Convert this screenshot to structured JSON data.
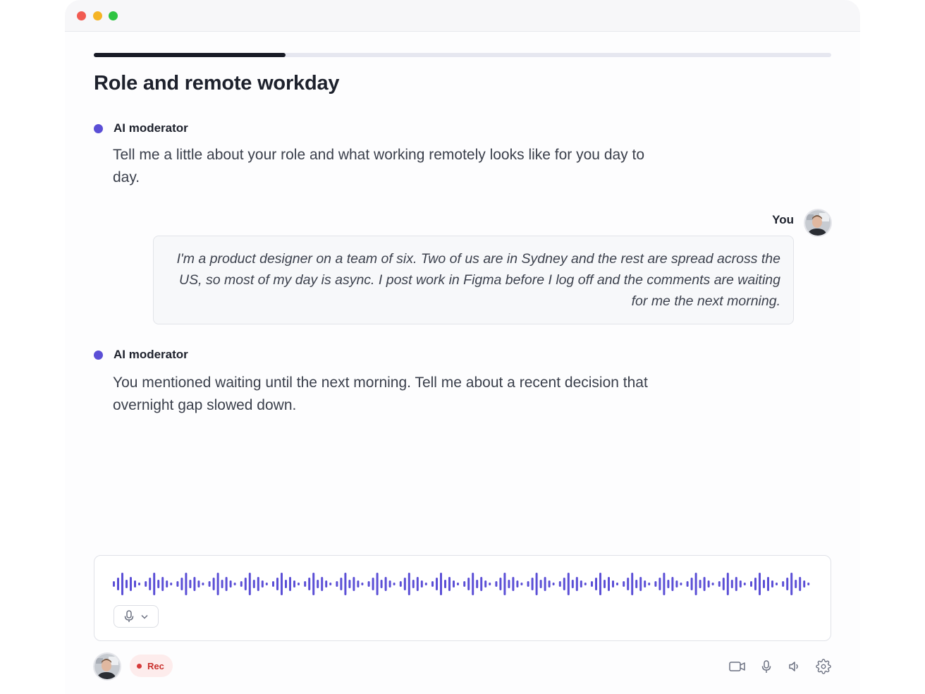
{
  "section": {
    "title": "Role and remote workday",
    "progress": 0.26
  },
  "messages": [
    {
      "speaker": "AI moderator",
      "text": "Tell me a little about your role and what working remotely looks like for you day to day."
    },
    {
      "speaker": "You",
      "text": "I'm a product designer on a team of six. Two of us are in Sydney and the rest are spread across the US, so most of my day is async. I post work in Figma before I log off and the comments are waiting for me the next morning."
    },
    {
      "speaker": "AI moderator",
      "text": "You mentioned waiting until the next morning. Tell me about a recent decision that overnight gap slowed down."
    }
  ],
  "recorder": {
    "rec_label": "Rec"
  },
  "icons": {
    "mic_select": "microphone-icon",
    "chevron": "chevron-down-icon",
    "controls": [
      "video-camera-icon",
      "microphone-icon",
      "speaker-icon",
      "gear-icon"
    ]
  },
  "colors": {
    "accent": "#5b4fd6",
    "waveform": "#5b4fd6",
    "progress_fill": "#181b26",
    "rec": "#d63a3a"
  }
}
